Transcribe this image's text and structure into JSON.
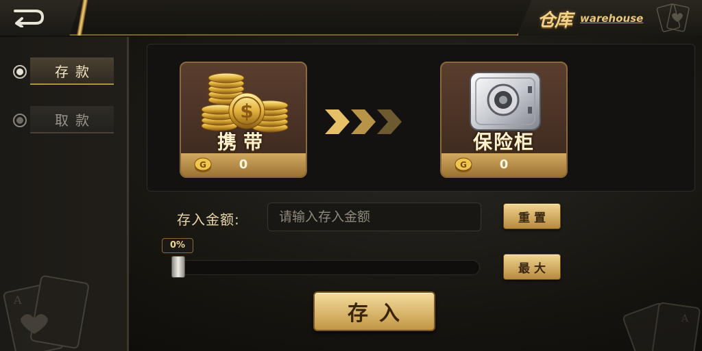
{
  "header": {
    "title_cn": "仓库",
    "title_en": "warehouse"
  },
  "sidebar": {
    "items": [
      {
        "label": "存款",
        "active": true
      },
      {
        "label": "取款",
        "active": false
      }
    ]
  },
  "tiles": {
    "carry": {
      "label": "携带",
      "value": "0",
      "icon": "gold-coins-icon"
    },
    "safe": {
      "label": "保险柜",
      "value": "0",
      "icon": "safe-icon"
    }
  },
  "form": {
    "amount_label": "存入金额:",
    "amount_placeholder": "请输入存入金额",
    "reset_label": "重置",
    "max_label": "最大",
    "percent_label": "0%",
    "slider_value": 0,
    "deposit_label": "存入"
  },
  "colors": {
    "accent_gold": "#d2aa62",
    "tile_brown": "#5a3e2e"
  }
}
